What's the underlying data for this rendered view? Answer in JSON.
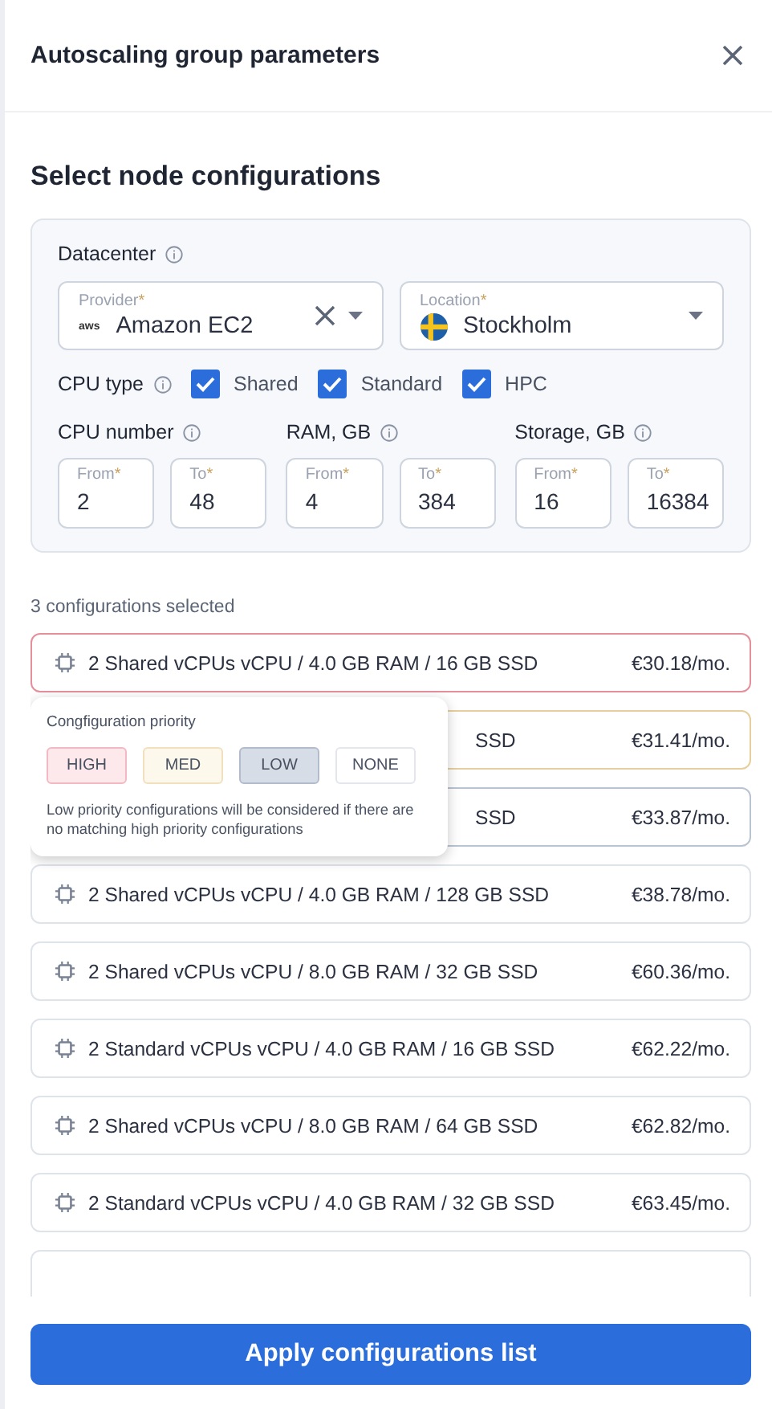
{
  "header": {
    "title": "Autoscaling group parameters"
  },
  "section_title": "Select node configurations",
  "filters": {
    "datacenter_label": "Datacenter",
    "provider": {
      "label": "Provider",
      "required_mark": "*",
      "value": "Amazon EC2",
      "logo_text": "aws"
    },
    "location": {
      "label": "Location",
      "required_mark": "*",
      "value": "Stockholm"
    },
    "cpu_type": {
      "label": "CPU type",
      "options": [
        {
          "label": "Shared",
          "checked": true
        },
        {
          "label": "Standard",
          "checked": true
        },
        {
          "label": "HPC",
          "checked": true
        }
      ]
    },
    "ranges": [
      {
        "label": "CPU number",
        "from": {
          "label": "From",
          "value": "2"
        },
        "to": {
          "label": "To",
          "value": "48"
        }
      },
      {
        "label": "RAM, GB",
        "from": {
          "label": "From",
          "value": "4"
        },
        "to": {
          "label": "To",
          "value": "384"
        }
      },
      {
        "label": "Storage, GB",
        "from": {
          "label": "From",
          "value": "16"
        },
        "to": {
          "label": "To",
          "value": "16384"
        }
      }
    ]
  },
  "selected_count": "3 configurations selected",
  "configurations": [
    {
      "spec": "2  Shared vCPUs vCPU / 4.0 GB RAM / 16 GB SSD",
      "price": "€30.18/mo.",
      "color": "#e58f9b",
      "covered": false
    },
    {
      "spec": "SSD",
      "price": "€31.41/mo.",
      "color": "#e6cf9c",
      "covered": true
    },
    {
      "spec": "SSD",
      "price": "€33.87/mo.",
      "color": "#b9c3d2",
      "covered": true
    },
    {
      "spec": "2  Shared vCPUs vCPU / 4.0 GB RAM / 128 GB SSD",
      "price": "€38.78/mo.",
      "color": "#dfe3ea",
      "covered": false
    },
    {
      "spec": "2  Shared vCPUs vCPU / 8.0 GB RAM / 32 GB SSD",
      "price": "€60.36/mo.",
      "color": "#dfe3ea",
      "covered": false
    },
    {
      "spec": "2  Standard vCPUs vCPU / 4.0 GB RAM / 16 GB SSD",
      "price": "€62.22/mo.",
      "color": "#dfe3ea",
      "covered": false
    },
    {
      "spec": "2  Shared vCPUs vCPU / 8.0 GB RAM / 64 GB SSD",
      "price": "€62.82/mo.",
      "color": "#dfe3ea",
      "covered": false
    },
    {
      "spec": "2  Standard vCPUs vCPU / 4.0 GB RAM / 32 GB SSD",
      "price": "€63.45/mo.",
      "color": "#dfe3ea",
      "covered": false
    }
  ],
  "priority_popover": {
    "title": "Congfiguration priority",
    "options": [
      {
        "label": "HIGH",
        "kind": "high",
        "selected": false
      },
      {
        "label": "MED",
        "kind": "med",
        "selected": false
      },
      {
        "label": "LOW",
        "kind": "low",
        "selected": true
      },
      {
        "label": "NONE",
        "kind": "none",
        "selected": false
      }
    ],
    "note": "Low priority configurations will be considered if there are no matching high priority configurations"
  },
  "apply_button": "Apply configurations list"
}
